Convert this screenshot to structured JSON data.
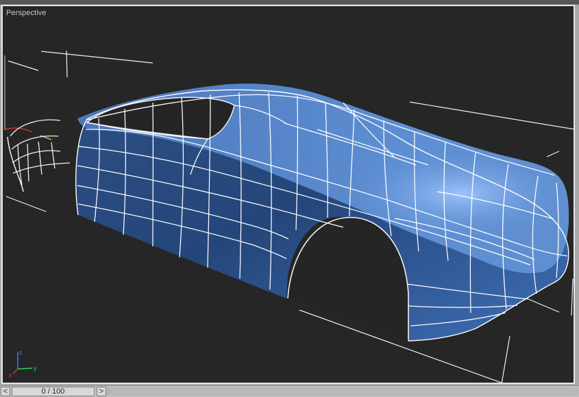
{
  "viewport": {
    "label": "Perspective"
  },
  "axis_gizmo": {
    "x_label": "x",
    "y_label": "y",
    "z_label": "z"
  },
  "timeline": {
    "frame_display": "0 / 100",
    "prev_icon": "<",
    "next_icon": ">"
  },
  "colors": {
    "viewport_bg": "#252625",
    "mesh_fill": "#3b66a8",
    "wireframe": "#ffffff",
    "gizmo_x": "#d23a3a",
    "gizmo_y": "#2fd15b",
    "gizmo_z": "#4a74ff"
  }
}
